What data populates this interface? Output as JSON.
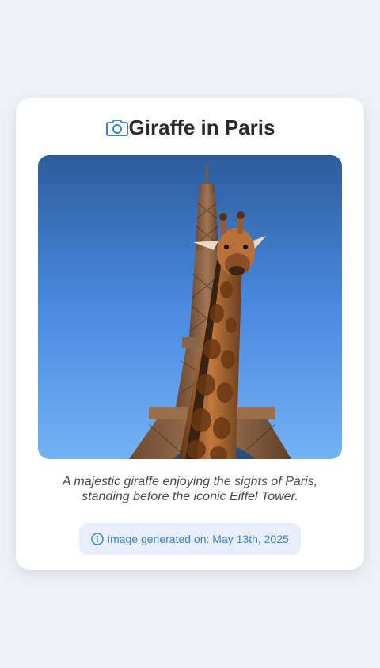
{
  "header": {
    "title": "Giraffe in Paris",
    "icon": "camera-icon"
  },
  "image": {
    "description_icon": "giraffe-eiffel-image"
  },
  "caption": {
    "line1": "A majestic giraffe enjoying the sights of Paris,",
    "line2": "standing before the iconic Eiffel Tower."
  },
  "badge": {
    "icon": "info-icon",
    "text": "Image generated on: May 13th, 2025"
  },
  "colors": {
    "page_bg": "#eef2f7",
    "card_bg": "#ffffff",
    "accent": "#3d85c6",
    "badge_bg": "#e8effb",
    "title": "#2b2b2b"
  }
}
